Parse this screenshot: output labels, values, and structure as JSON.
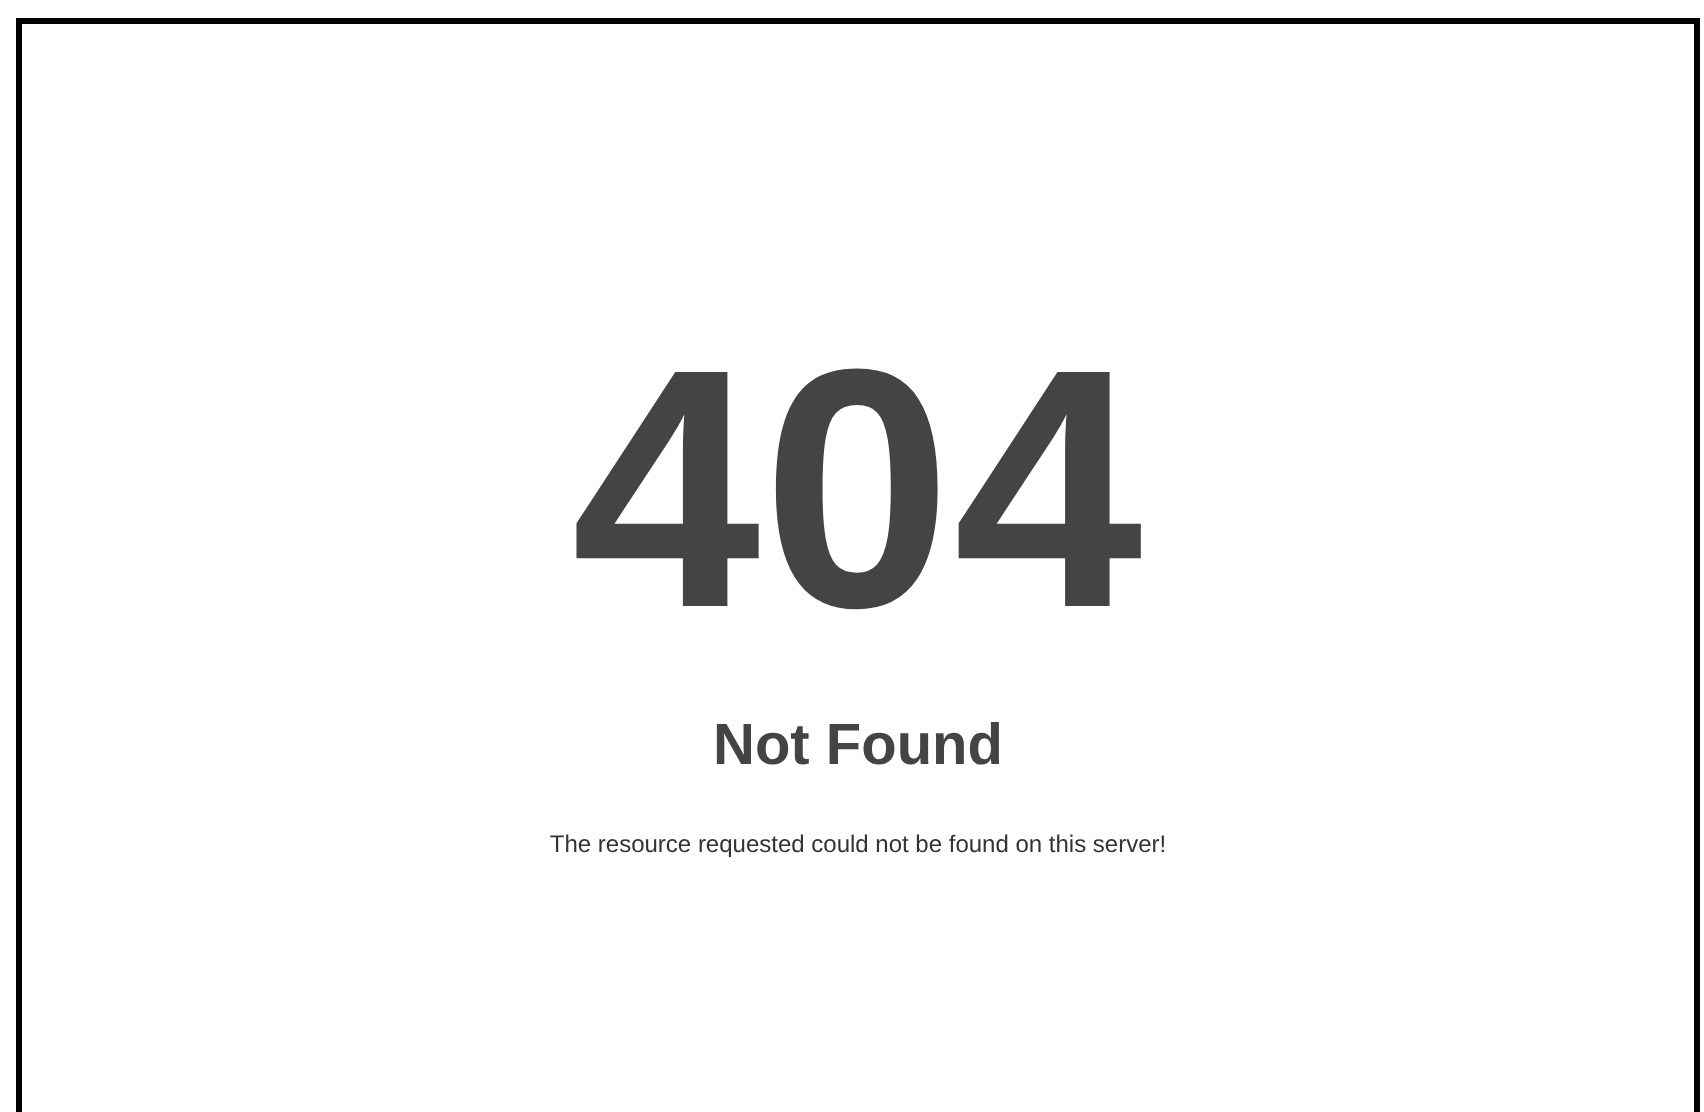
{
  "error": {
    "code": "404",
    "title": "Not Found",
    "message": "The resource requested could not be found on this server!"
  }
}
